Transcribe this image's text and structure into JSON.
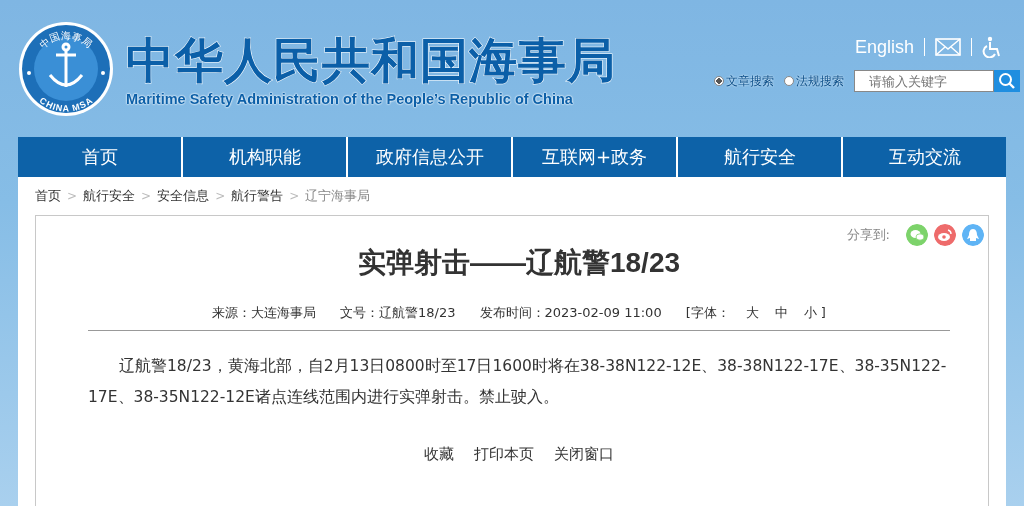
{
  "header": {
    "logo": {
      "ring_text": "中国海事局",
      "bottom_text": "CHINA MSA"
    },
    "title": "中华人民共和国海事局",
    "subtitle": "Maritime Safety Administration of the People’s Republic of China",
    "links": {
      "english": "English"
    },
    "search": {
      "options": [
        {
          "label": "文章搜索",
          "selected": true
        },
        {
          "label": "法规搜索",
          "selected": false
        }
      ],
      "placeholder": "请输入关键字"
    }
  },
  "nav": [
    {
      "label": "首页"
    },
    {
      "label": "机构职能"
    },
    {
      "label": "政府信息公开"
    },
    {
      "label": "互联网+政务"
    },
    {
      "label": "航行安全"
    },
    {
      "label": "互动交流"
    }
  ],
  "breadcrumb": [
    {
      "label": "首页"
    },
    {
      "separator": ">",
      "label": "航行安全"
    },
    {
      "separator": ">",
      "label": "安全信息"
    },
    {
      "separator": ">",
      "label": "航行警告"
    },
    {
      "separator": ">",
      "label": "辽宁海事局",
      "current": true
    }
  ],
  "article": {
    "share_label": "分享到:",
    "share": [
      {
        "kind": "wechat",
        "color": "#7dd36b"
      },
      {
        "kind": "weibo",
        "color": "#ee6b6b"
      },
      {
        "kind": "qq",
        "color": "#5fb4f5"
      }
    ],
    "title": "实弹射击——辽航警18/23",
    "meta": [
      {
        "label": "来源：",
        "value": "大连海事局"
      },
      {
        "label": "文号：",
        "value": "辽航警18/23"
      },
      {
        "label": "发布时间：",
        "value": "2023-02-09 11:00"
      }
    ],
    "font_label": "[字体：",
    "font_sizes": [
      "大",
      "中",
      "小 ]"
    ],
    "body": "辽航警18/23，黄海北部，自2月13日0800时至17日1600时将在38-38N122-12E、38-38N122-17E、38-35N122-17E、38-35N122-12E诸点连线范围内进行实弹射击。禁止驶入。",
    "actions": [
      "收藏",
      "打印本页",
      "关闭窗口"
    ]
  }
}
